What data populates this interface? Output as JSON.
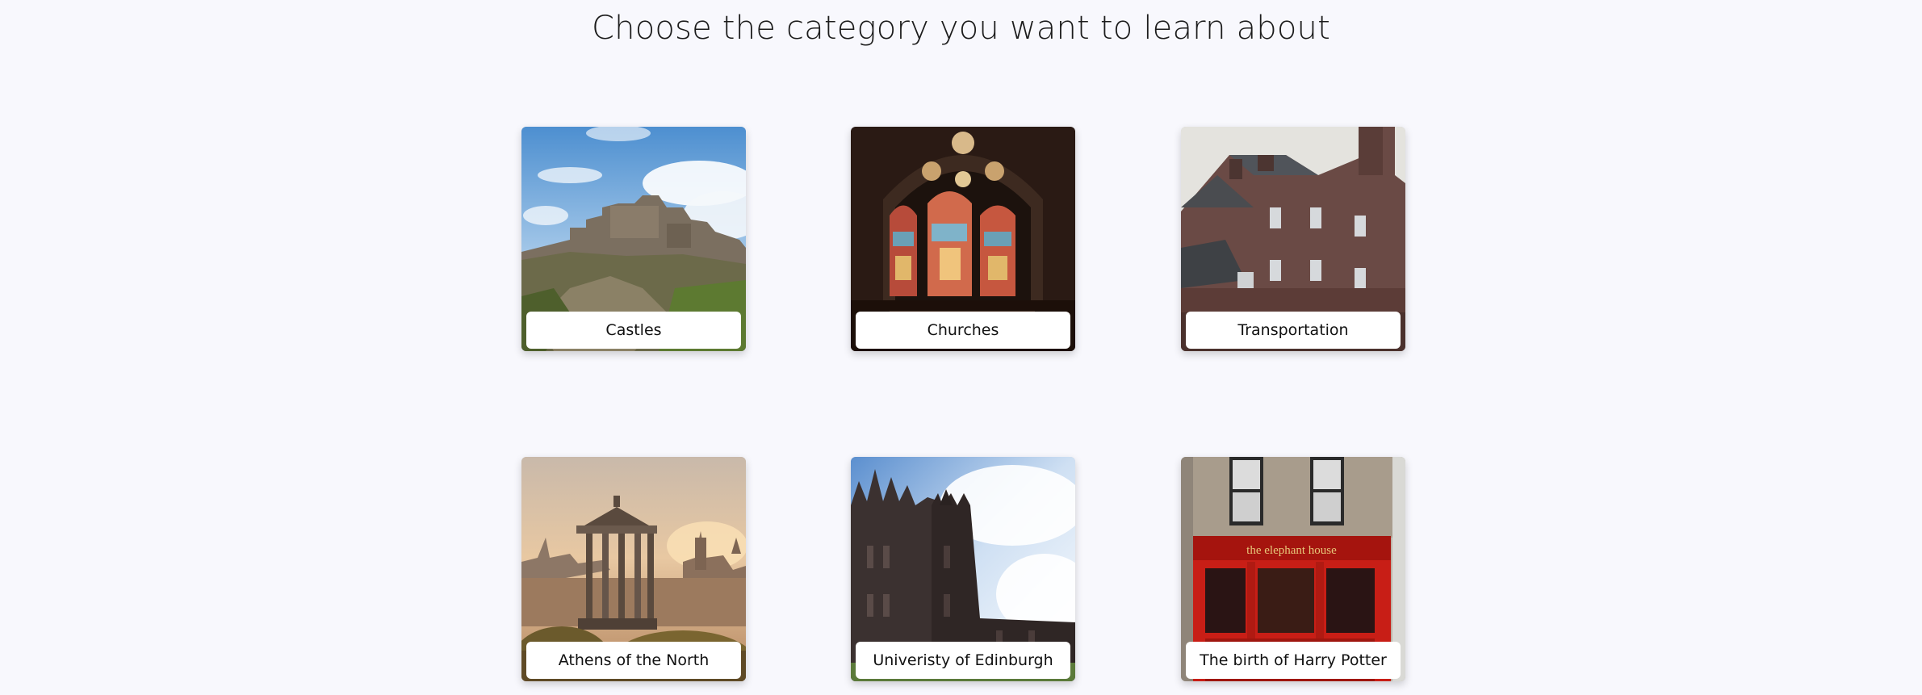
{
  "page": {
    "heading": "Choose the category you want to learn about"
  },
  "categories": [
    {
      "label": "Castles",
      "image": "castle-photo"
    },
    {
      "label": "Churches",
      "image": "stained-glass-window-photo"
    },
    {
      "label": "Transportation",
      "image": "stone-building-photo"
    },
    {
      "label": "Athens of the North",
      "image": "dugald-stewart-monument-photo"
    },
    {
      "label": "Univeristy of Edinburgh",
      "image": "gothic-college-photo"
    },
    {
      "label": "The birth of Harry Potter",
      "image": "elephant-house-cafe-photo"
    }
  ],
  "signs": {
    "elephant_house": "the elephant house"
  },
  "colors": {
    "background": "#f8f8fd",
    "label_background": "#ffffff",
    "text": "#111111"
  }
}
